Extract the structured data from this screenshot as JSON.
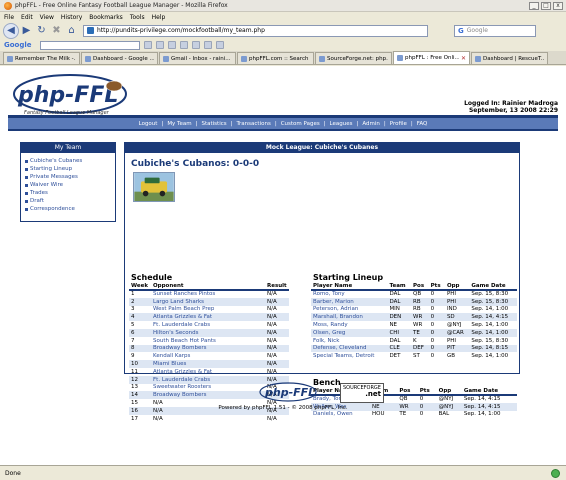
{
  "window": {
    "title": "phpFFL - Free Online Fantasy Football League Manager - Mozilla Firefox",
    "buttons": [
      "_",
      "□",
      "x"
    ]
  },
  "menubar": [
    "File",
    "Edit",
    "View",
    "History",
    "Bookmarks",
    "Tools",
    "Help"
  ],
  "navbar": {
    "url": "http://pundits-privilege.com/mockfootball/my_team.php",
    "search_placeholder": "Google",
    "search_engine": "G"
  },
  "google_toolbar": {
    "label": "Google"
  },
  "tabs": [
    {
      "label": "Remember The Milk -..."
    },
    {
      "label": "Dashboard - Google ..."
    },
    {
      "label": "Gmail - Inbox - raini..."
    },
    {
      "label": "phpFFL.com :: Search"
    },
    {
      "label": "SourceForge.net: php..."
    },
    {
      "label": "phpFFL : Free Onli..."
    },
    {
      "label": "Dashboard | RescueT..."
    }
  ],
  "active_tab": 5,
  "header": {
    "logo_text": "php-FFL",
    "logo_subtitle": "Fantasy Football League Manager",
    "logged_in_line": "Logged In: Rainier Madroga",
    "date_line": "September, 13 2008 22:29"
  },
  "nav_links": [
    "Logout",
    "My Team",
    "Statistics",
    "Transactions",
    "Custom Pages",
    "Leagues",
    "Admin",
    "Profile",
    "FAQ"
  ],
  "sidebar": {
    "title": "My Team",
    "items": [
      "Cubiche's Cubanes",
      "Starting Lineup",
      "Private Messages",
      "Waiver Wire",
      "Trades",
      "Draft",
      "Correspondence"
    ]
  },
  "main": {
    "header": "Mock League: Cubiche's Cubanes",
    "team_record": "Cubiche's Cubanos: 0-0-0"
  },
  "schedule": {
    "title": "Schedule",
    "columns": [
      "Week",
      "Opponent",
      "Result"
    ],
    "rows": [
      [
        "1",
        "Sunset Ranches Pintos",
        "N/A"
      ],
      [
        "2",
        "Largo Land Sharks",
        "N/A"
      ],
      [
        "3",
        "West Palm Beach Prep",
        "N/A"
      ],
      [
        "4",
        "Atlanta Grizzles & Fat",
        "N/A"
      ],
      [
        "5",
        "Ft. Lauderdale Crabs",
        "N/A"
      ],
      [
        "6",
        "Hilton's Seconds",
        "N/A"
      ],
      [
        "7",
        "South Beach Hot Pants",
        "N/A"
      ],
      [
        "8",
        "Broadway Bombers",
        "N/A"
      ],
      [
        "9",
        "Kendall Karps",
        "N/A"
      ],
      [
        "10",
        "Miami Blues",
        "N/A"
      ],
      [
        "11",
        "Atlanta Grizzles & Fat",
        "N/A"
      ],
      [
        "12",
        "Ft. Lauderdale Crabs",
        "N/A"
      ],
      [
        "13",
        "Sweetwater Roosters",
        "N/A"
      ],
      [
        "14",
        "Broadway Bombers",
        "N/A"
      ],
      [
        "15",
        "N/A",
        "N/A"
      ],
      [
        "16",
        "N/A",
        "N/A"
      ],
      [
        "17",
        "N/A",
        "N/A"
      ]
    ]
  },
  "lineup": {
    "title": "Starting Lineup",
    "columns": [
      "Player Name",
      "Team",
      "Pos",
      "Pts",
      "Opp",
      "Game Date"
    ],
    "rows": [
      [
        "Romo, Tony",
        "DAL",
        "QB",
        "0",
        "PHI",
        "Sep. 15, 8:30"
      ],
      [
        "Barber, Marion",
        "DAL",
        "RB",
        "0",
        "PHI",
        "Sep. 15, 8:30"
      ],
      [
        "Peterson, Adrian",
        "MIN",
        "RB",
        "0",
        "IND",
        "Sep. 14, 1:00"
      ],
      [
        "Marshall, Brandon",
        "DEN",
        "WR",
        "0",
        "SD",
        "Sep. 14, 4:15"
      ],
      [
        "Moss, Randy",
        "NE",
        "WR",
        "0",
        "@NYJ",
        "Sep. 14, 1:00"
      ],
      [
        "Olsen, Greg",
        "CHI",
        "TE",
        "0",
        "@CAR",
        "Sep. 14, 1:00"
      ],
      [
        "Folk, Nick",
        "DAL",
        "K",
        "0",
        "PHI",
        "Sep. 15, 8:30"
      ],
      [
        "Defense, Cleveland",
        "CLE",
        "DEF",
        "0",
        "PIT",
        "Sep. 14, 8:15"
      ],
      [
        "Special Teams, Detroit",
        "DET",
        "ST",
        "0",
        "GB",
        "Sep. 14, 1:00"
      ]
    ]
  },
  "bench": {
    "title": "Bench",
    "columns": [
      "Player Name",
      "Team",
      "Pos",
      "Pts",
      "Opp",
      "Game Date"
    ],
    "rows": [
      [
        "Brady, Tom",
        "NE",
        "QB",
        "0",
        "@NYJ",
        "Sep. 14, 4:15"
      ],
      [
        "Welker, Wes",
        "NE",
        "WR",
        "0",
        "@NYJ",
        "Sep. 14, 4:15"
      ],
      [
        "Daniels, Owen",
        "HOU",
        "TE",
        "0",
        "BAL",
        "Sep. 14, 1:00"
      ]
    ]
  },
  "footer": {
    "powered_by": "Powered by phpFFL 1.51 - © 2008 phpFFL, Inc.",
    "sf_label": "SOURCEFORGE",
    "sf_net": ".net"
  },
  "status": {
    "text": "Done"
  },
  "colors": {
    "brand_navy": "#1b3a78",
    "nav_blue": "#5a7ab8",
    "link_blue": "#2e4f9a",
    "band": "#dde6f3"
  }
}
